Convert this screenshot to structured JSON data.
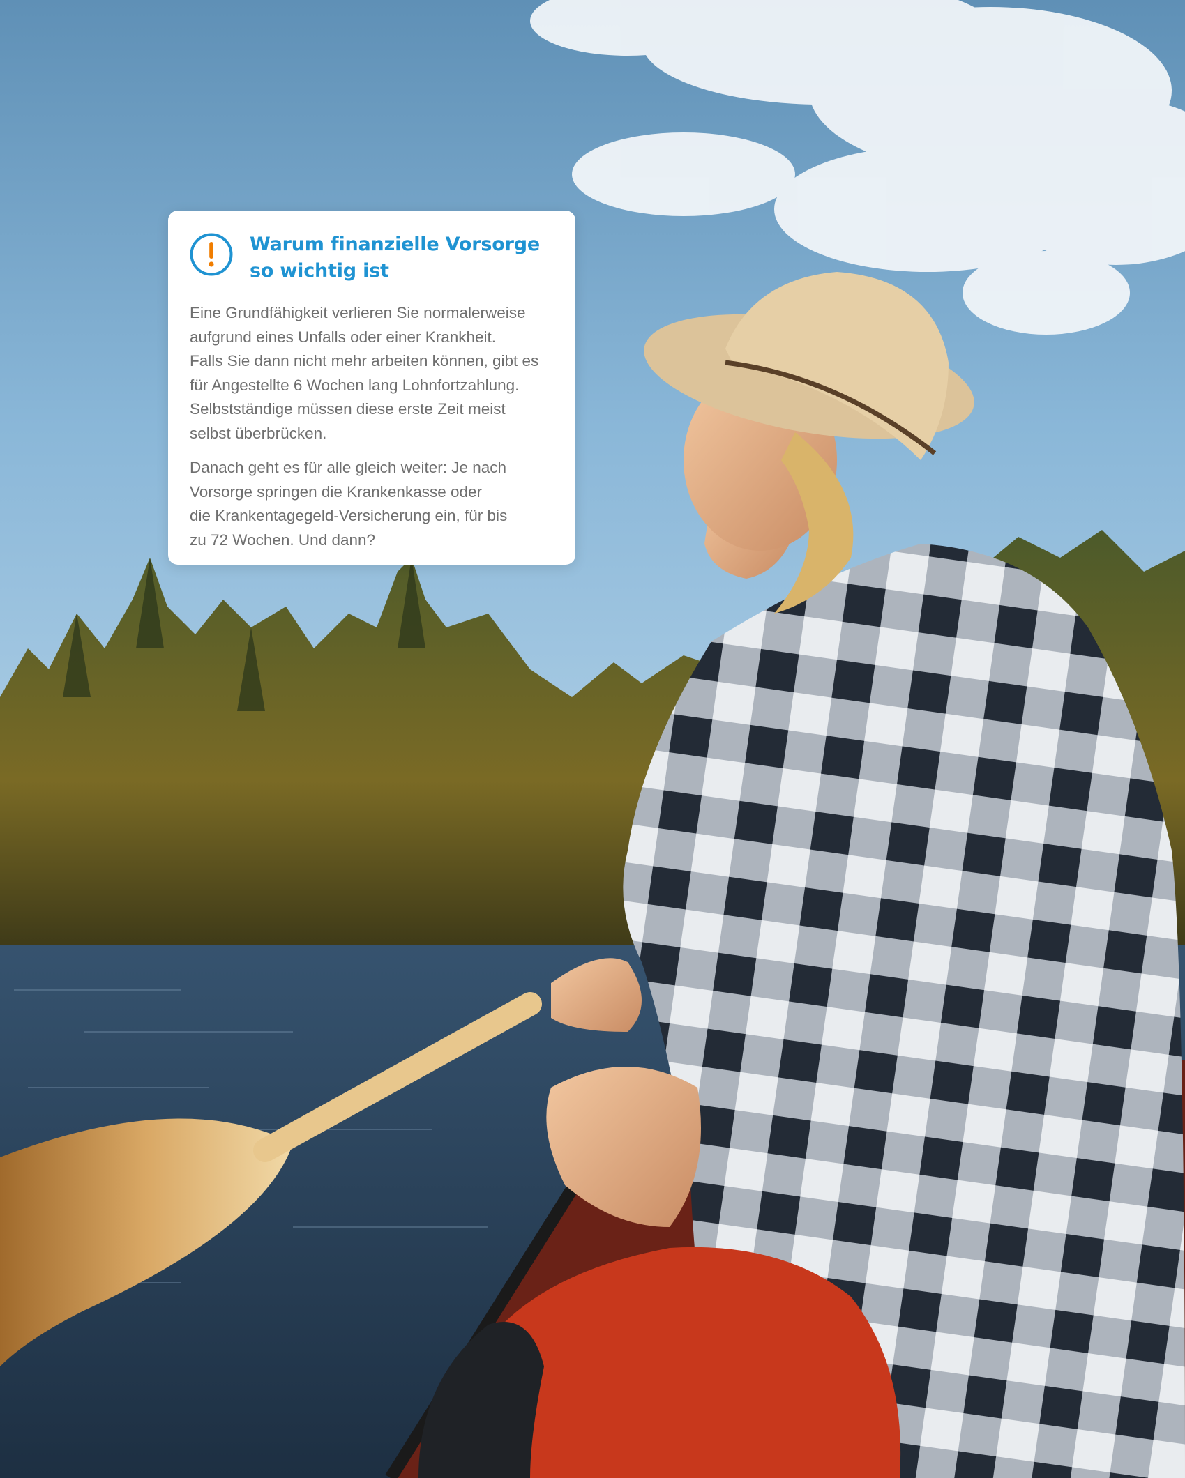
{
  "info_card": {
    "icon": "exclamation-circle-icon",
    "accent_color": "#1f93d2",
    "icon_color": "#f07d00",
    "title_lines": [
      "Warum finanzielle Vorsorge",
      "so wichtig ist"
    ],
    "paragraph_1_lines": [
      "Eine Grundfähigkeit verlieren Sie normalerweise",
      "aufgrund eines Unfalls oder einer Krankheit.",
      "Falls Sie dann nicht mehr arbeiten können, gibt es",
      "für Angestellte 6 Wochen lang Lohnfortzahlung.",
      "Selbstständige müssen diese erste Zeit meist",
      "selbst überbrücken."
    ],
    "paragraph_2_lines": [
      "Danach geht es für alle gleich weiter: Je nach",
      "Vorsorge springen die Krankenkasse oder",
      "die Krankentagegeld-Versicherung ein, für bis",
      "zu 72 Wochen. Und dann?"
    ]
  }
}
